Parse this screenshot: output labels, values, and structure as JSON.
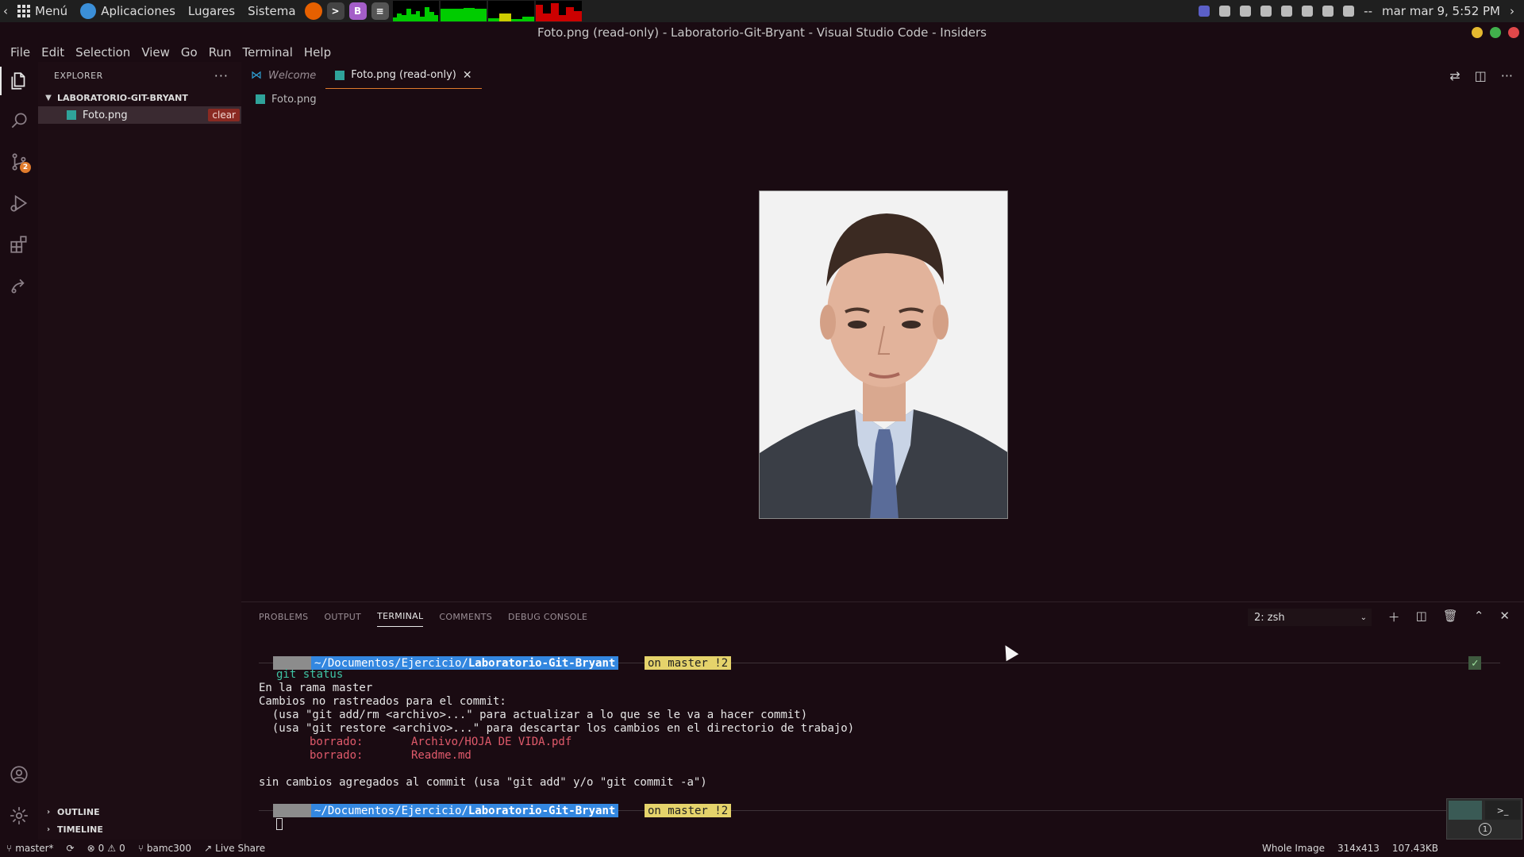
{
  "system_panel": {
    "menu_label": "Menú",
    "apps_label": "Aplicaciones",
    "places_label": "Lugares",
    "system_label": "Sistema",
    "datetime": "mar mar 9, 5:52 PM",
    "network_status": "--"
  },
  "window": {
    "title": "Foto.png (read-only) - Laboratorio-Git-Bryant - Visual Studio Code - Insiders"
  },
  "menu": [
    "File",
    "Edit",
    "Selection",
    "View",
    "Go",
    "Run",
    "Terminal",
    "Help"
  ],
  "activity": {
    "source_control_badge": "2"
  },
  "sidebar": {
    "title": "EXPLORER",
    "folder": "LABORATORIO-GIT-BRYANT",
    "file": "Foto.png",
    "hover_tip": "clear",
    "outline": "OUTLINE",
    "timeline": "TIMELINE"
  },
  "tabs": [
    {
      "label": "Welcome",
      "active": false
    },
    {
      "label": "Foto.png (read-only)",
      "active": true
    }
  ],
  "breadcrumb": "Foto.png",
  "panel": {
    "tabs": [
      "PROBLEMS",
      "OUTPUT",
      "TERMINAL",
      "COMMENTS",
      "DEBUG CONSOLE"
    ],
    "active_tab": "TERMINAL",
    "terminal_select": "2: zsh"
  },
  "terminal": {
    "prompt_path_prefix": " ~/Documentos/Ejercicio/",
    "prompt_path_bold": "Laboratorio-Git-Bryant",
    "prompt_git": " on   master !2 ",
    "command": "git status",
    "lines": [
      "En la rama master",
      "Cambios no rastreados para el commit:",
      "  (usa \"git add/rm <archivo>...\" para actualizar a lo que se le va a hacer commit)",
      "  (usa \"git restore <archivo>...\" para descartar los cambios en el directorio de trabajo)"
    ],
    "deleted": [
      {
        "label": "borrado:",
        "path": "Archivo/HOJA DE VIDA.pdf"
      },
      {
        "label": "borrado:",
        "path": "Readme.md"
      }
    ],
    "summary": "sin cambios agregados al commit (usa \"git add\" y/o \"git commit -a\")",
    "ok_mark": "✓"
  },
  "status_bar": {
    "branch": "master*",
    "errors": "0",
    "warnings": "0",
    "user": "bamc300",
    "live_share": "Live Share",
    "zoom": "Whole Image",
    "dimensions": "314x413",
    "size": "107.43KB"
  },
  "dock": {
    "workspace": "1"
  },
  "colors": {
    "accent": "#e07b2c",
    "background": "#1a0b12",
    "prompt_path": "#3387e0",
    "prompt_git": "#e5d36b",
    "deleted_text": "#e05a6b"
  }
}
